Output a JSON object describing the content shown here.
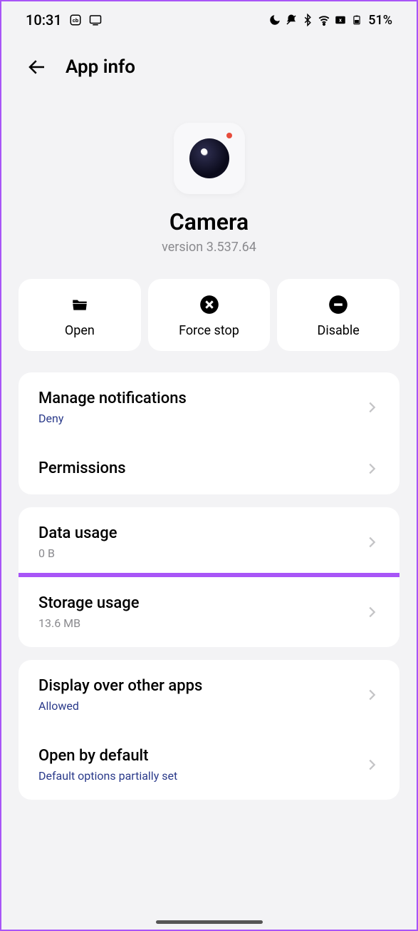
{
  "status": {
    "time": "10:31",
    "battery": "51%"
  },
  "header": {
    "title": "App info"
  },
  "app": {
    "name": "Camera",
    "version": "version 3.537.64"
  },
  "actions": {
    "open": "Open",
    "force_stop": "Force stop",
    "disable": "Disable"
  },
  "settings": {
    "notifications": {
      "title": "Manage notifications",
      "sub": "Deny"
    },
    "permissions": {
      "title": "Permissions"
    },
    "data_usage": {
      "title": "Data usage",
      "sub": "0 B"
    },
    "storage": {
      "title": "Storage usage",
      "sub": "13.6 MB"
    },
    "display_over": {
      "title": "Display over other apps",
      "sub": "Allowed"
    },
    "open_default": {
      "title": "Open by default",
      "sub": "Default options partially set"
    }
  }
}
